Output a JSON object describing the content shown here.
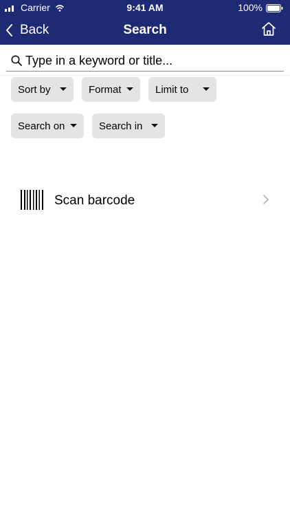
{
  "status_bar": {
    "carrier": "Carrier",
    "time": "9:41 AM",
    "battery": "100%"
  },
  "navbar": {
    "back_label": "Back",
    "title": "Search",
    "background": "#1f2a74",
    "home_icon": "home-icon"
  },
  "search": {
    "placeholder": "Type in a keyword or title...",
    "value": ""
  },
  "filters": [
    {
      "label": "Sort by"
    },
    {
      "label": "Format"
    },
    {
      "label": "Limit to"
    },
    {
      "label": "Search on"
    },
    {
      "label": "Search in"
    }
  ],
  "scan": {
    "label": "Scan barcode",
    "icon": "barcode-icon"
  }
}
